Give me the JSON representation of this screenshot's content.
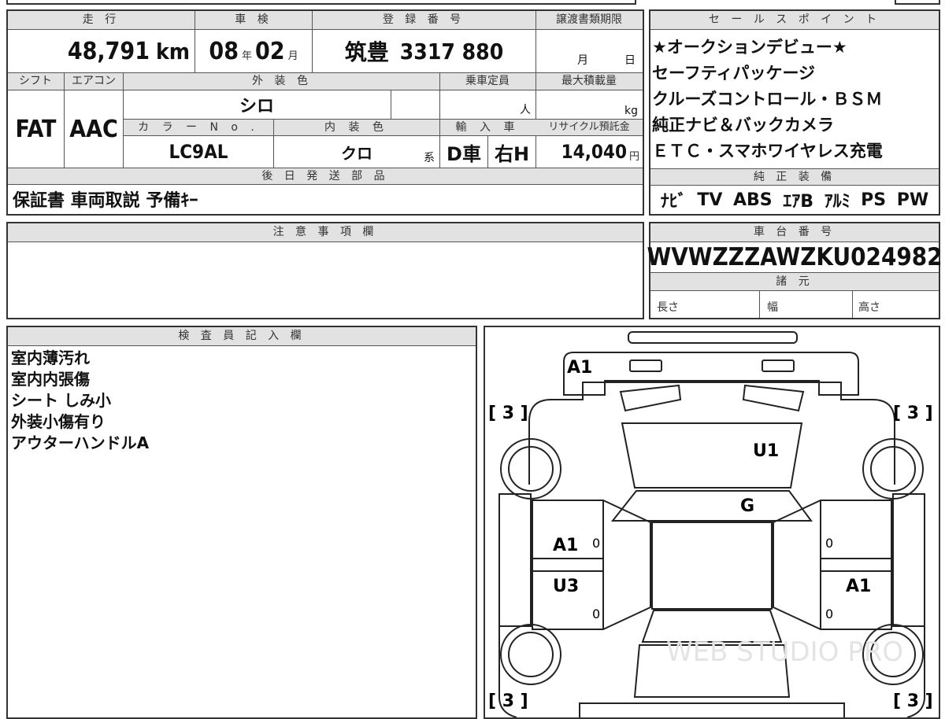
{
  "main_info": {
    "headers": {
      "mileage": "走 行",
      "inspection": "車 検",
      "registration": "登 録 番 号",
      "transfer_deadline": "譲渡書類期限",
      "shift": "シフト",
      "aircon": "エアコン",
      "exterior_color": "外 装 色",
      "capacity": "乗車定員",
      "max_load": "最大積載量",
      "color_no": "カ ラ ー N o .",
      "interior_color": "内 装 色",
      "import": "輸 入 車",
      "recycle": "リサイクル預託金"
    },
    "mileage_value": "48,791",
    "mileage_unit": "km",
    "inspection_year": "08",
    "inspection_year_unit": "年",
    "inspection_month": "02",
    "inspection_month_unit": "月",
    "registration_region": "筑豊",
    "registration_number": "3317 880",
    "transfer_month_unit": "月",
    "transfer_day_unit": "日",
    "shift_value": "FAT",
    "aircon_value": "AAC",
    "exterior_color_value": "シロ",
    "capacity_unit": "人",
    "max_load_unit": "kg",
    "color_no_value": "LC9AL",
    "interior_color_value": "クロ",
    "interior_color_suffix": "系",
    "import_dealer": "D車",
    "import_handle": "右H",
    "recycle_value": "14,040",
    "recycle_unit": "円"
  },
  "shipping": {
    "header": "後 日 発 送 部 品",
    "items": "保証書 車両取説 予備ｷｰ"
  },
  "sales_points": {
    "header": "セ ー ル ス ポ イ ン ト",
    "lines": [
      "★オークションデビュー★",
      "セーフティパッケージ",
      "クルーズコントロール・ＢＳＭ",
      "純正ナビ＆バックカメラ",
      "ＥＴＣ・スマホワイヤレス充電"
    ]
  },
  "factory_equipment": {
    "header": "純 正 装 備",
    "items": [
      "ﾅﾋﾞ",
      "TV",
      "ABS",
      "ｴｱB",
      "ｱﾙﾐ",
      "PS",
      "PW"
    ]
  },
  "notes": {
    "header": "注 意 事 項 欄"
  },
  "chassis": {
    "header": "車 台 番 号",
    "value": "WVWZZZAWZKU024982",
    "specs_header": "諸 元",
    "length_label": "長さ",
    "width_label": "幅",
    "height_label": "高さ"
  },
  "inspector": {
    "header": "検 査 員 記 入 欄",
    "lines": [
      "室内薄汚れ",
      "室内内張傷",
      "シート しみ小",
      "外装小傷有り",
      "アウターハンドルA"
    ]
  },
  "diagram": {
    "marks": {
      "front_bumper": "A1",
      "hood": "U1",
      "windshield": "G",
      "left_front_door": "A1",
      "left_rear_door": "U3",
      "right_rear_door": "A1",
      "door_zero": "0"
    },
    "tires": {
      "front_left": "[ 3 ]",
      "front_right": "[ 3 ]",
      "rear_left": "[ 3 ]",
      "rear_right": "[ 3 ]"
    },
    "watermark": "WEB STUDIO PRO"
  }
}
